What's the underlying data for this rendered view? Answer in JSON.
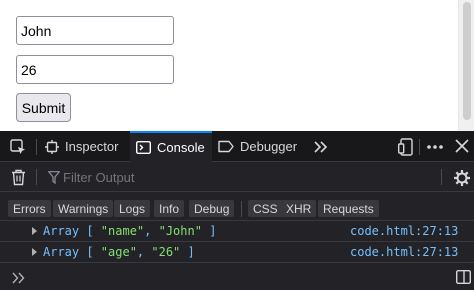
{
  "page": {
    "name_value": "John",
    "age_value": "26",
    "submit_label": "Submit"
  },
  "devtools": {
    "tabs": [
      {
        "label": "Inspector",
        "icon": "inspector-icon"
      },
      {
        "label": "Console",
        "icon": "console-icon",
        "selected": true
      },
      {
        "label": "Debugger",
        "icon": "debugger-icon"
      }
    ],
    "filter_placeholder": "Filter Output",
    "levels": [
      "Errors",
      "Warnings",
      "Logs",
      "Info",
      "Debug"
    ],
    "types": [
      "CSS",
      "XHR",
      "Requests"
    ],
    "logs": [
      {
        "prefix": "Array [ ",
        "items": [
          "\"name\"",
          "\"John\""
        ],
        "suffix": " ]",
        "source": "code.html:27:13"
      },
      {
        "prefix": "Array [ ",
        "items": [
          "\"age\"",
          "\"26\""
        ],
        "suffix": " ]",
        "source": "code.html:27:13"
      }
    ],
    "colors": {
      "accent": "#0a84ff",
      "background": "#232327",
      "toolbar": "#18181a",
      "string": "#86de74",
      "link": "#75bfff"
    }
  }
}
